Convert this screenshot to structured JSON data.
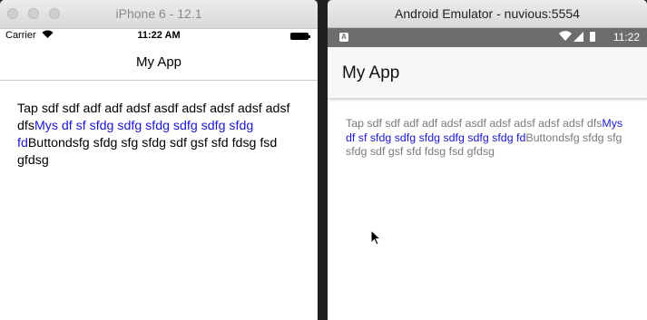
{
  "ios": {
    "window_title": "iPhone 6 - 12.1",
    "carrier": "Carrier",
    "time": "11:22 AM",
    "nav_title": "My App",
    "text_before": "Tap sdf sdf adf adf adsf asdf adsf adsf adsf adsf dfs",
    "link_text": "Mys df sf sfdg sdfg sfdg sdfg sdfg sfdg fd",
    "text_after": "Buttondsfg sfdg sfg sfdg sdf gsf sfd fdsg fsd gfdsg"
  },
  "android": {
    "window_title": "Android Emulator - nuvious:5554",
    "time": "11:22",
    "app_title": "My App",
    "text_before": "Tap sdf sdf adf adf adsf asdf adsf adsf adsf adsf dfs",
    "link_text": "Mys df sf sfdg sdfg sfdg sdfg sdfg sfdg fd",
    "text_after": "Buttondsfg sfdg sfg sfdg sdf gsf sfd fdsg fsd gfdsg"
  },
  "colors": {
    "link": "#1c16d0",
    "android_text": "#7a7a7a",
    "android_statusbar": "#6d6d6d"
  }
}
